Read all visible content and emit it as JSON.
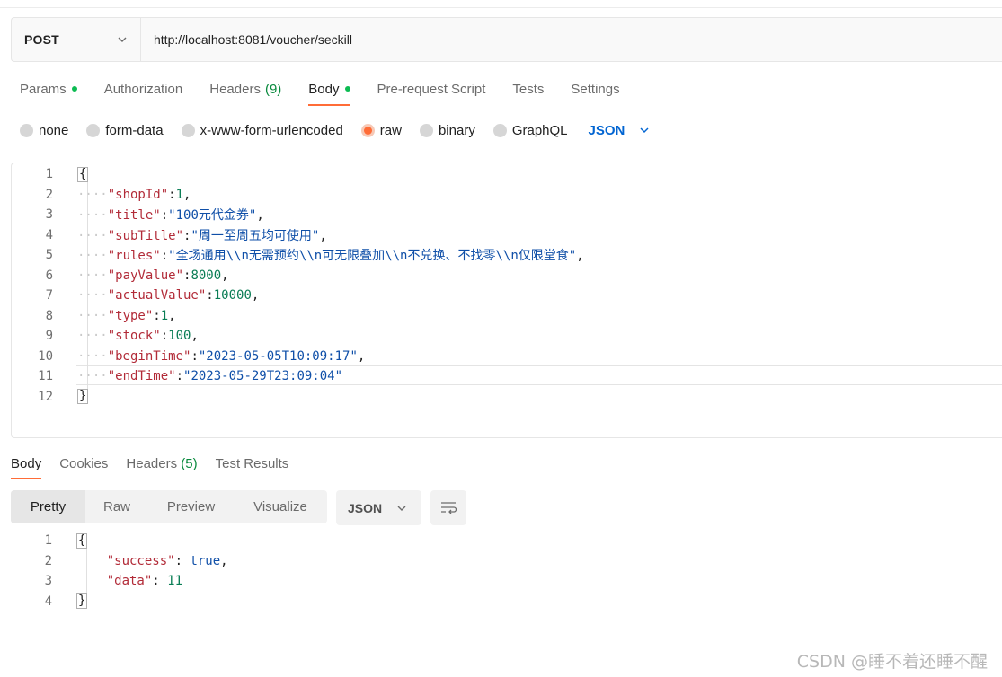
{
  "request": {
    "method": "POST",
    "url": "http://localhost:8081/voucher/seckill",
    "tabs": [
      {
        "label": "Params",
        "dot": true
      },
      {
        "label": "Authorization"
      },
      {
        "label": "Headers",
        "count": "(9)"
      },
      {
        "label": "Body",
        "dot": true,
        "active": true
      },
      {
        "label": "Pre-request Script"
      },
      {
        "label": "Tests"
      },
      {
        "label": "Settings"
      }
    ],
    "body_types": [
      "none",
      "form-data",
      "x-www-form-urlencoded",
      "raw",
      "binary",
      "GraphQL"
    ],
    "selected_body_type": "raw",
    "language": "JSON",
    "line_numbers": [
      "1",
      "2",
      "3",
      "4",
      "5",
      "6",
      "7",
      "8",
      "9",
      "10",
      "11",
      "12"
    ],
    "body_fields": [
      {
        "key": "\"shopId\"",
        "value": "1",
        "kind": "num",
        "comma": ","
      },
      {
        "key": "\"title\"",
        "value": "\"100元代金券\"",
        "kind": "str",
        "comma": ","
      },
      {
        "key": "\"subTitle\"",
        "value": "\"周一至周五均可使用\"",
        "kind": "str",
        "comma": ","
      },
      {
        "key": "\"rules\"",
        "value": "\"全场通用\\\\n无需预约\\\\n可无限叠加\\\\n不兑换、不找零\\\\n仅限堂食\"",
        "kind": "str",
        "comma": ","
      },
      {
        "key": "\"payValue\"",
        "value": "8000",
        "kind": "num",
        "comma": ","
      },
      {
        "key": "\"actualValue\"",
        "value": "10000",
        "kind": "num",
        "comma": ","
      },
      {
        "key": "\"type\"",
        "value": "1",
        "kind": "num",
        "comma": ","
      },
      {
        "key": "\"stock\"",
        "value": "100",
        "kind": "num",
        "comma": ","
      },
      {
        "key": "\"beginTime\"",
        "value": "\"2023-05-05T10:09:17\"",
        "kind": "str",
        "comma": ","
      },
      {
        "key": "\"endTime\"",
        "value": "\"2023-05-29T23:09:04\"",
        "kind": "str",
        "comma": ""
      }
    ]
  },
  "response": {
    "tabs": [
      {
        "label": "Body",
        "active": true
      },
      {
        "label": "Cookies"
      },
      {
        "label": "Headers",
        "count": "(5)"
      },
      {
        "label": "Test Results"
      }
    ],
    "views": [
      "Pretty",
      "Raw",
      "Preview",
      "Visualize"
    ],
    "active_view": "Pretty",
    "language": "JSON",
    "line_numbers": [
      "1",
      "2",
      "3",
      "4"
    ],
    "fields": [
      {
        "key": "\"success\"",
        "value": "true",
        "kind": "kw",
        "comma": ","
      },
      {
        "key": "\"data\"",
        "value": "11",
        "kind": "num",
        "comma": ""
      }
    ]
  },
  "watermark": "CSDN @睡不着还睡不醒",
  "colors": {
    "accent": "#ff6c37",
    "dot": "#0cbb52",
    "link": "#0265d2",
    "key": "#b22b38",
    "string": "#0f4fa8",
    "number": "#0a7d55"
  }
}
